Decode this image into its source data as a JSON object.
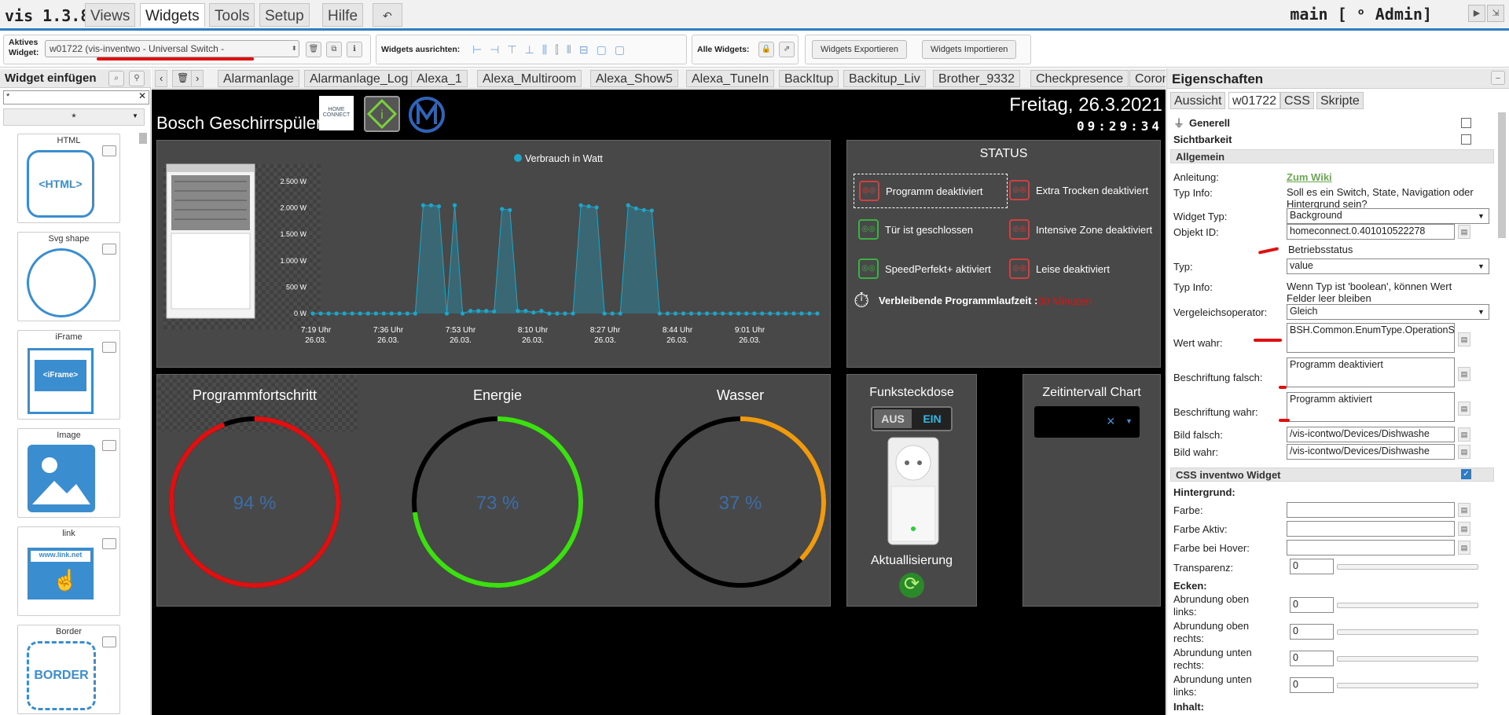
{
  "app": {
    "version": "vis 1.3.8",
    "menu": [
      "Views",
      "Widgets",
      "Tools",
      "Setup",
      "Hilfe"
    ],
    "undo": "↶",
    "project": "main [ ᵒ Admin]"
  },
  "toolbar": {
    "active_label_1": "Aktives",
    "active_label_2": "Widget:",
    "active_widget": "w01722 (vis-inventwo - Universal Switch -",
    "align_label": "Widgets ausrichten:",
    "all_label": "Alle Widgets:",
    "export": "Widgets Exportieren",
    "import": "Widgets Importieren"
  },
  "palette": {
    "title": "Widget einfügen",
    "filter": "*",
    "category": "*",
    "widgets": [
      {
        "name": "HTML",
        "glyph": "<HTML>"
      },
      {
        "name": "Svg shape",
        "glyph": ""
      },
      {
        "name": "iFrame",
        "glyph": "<iFrame>"
      },
      {
        "name": "Image",
        "glyph": ""
      },
      {
        "name": "link",
        "glyph": "www.link.net"
      },
      {
        "name": "Border",
        "glyph": "BORDER"
      }
    ]
  },
  "views": [
    "Alarmanlage",
    "Alarmanlage_Log",
    "Alexa_1",
    "Alexa_Multiroom",
    "Alexa_Show5",
    "Alexa_TuneIn",
    "BackItup",
    "Backitup_Liv",
    "Brother_9332",
    "Checkpresence",
    "Corona_A"
  ],
  "dashboard": {
    "title": "Bosch Geschirrspüler",
    "homeconnect": "HOME CONNECT",
    "date": "Freitag, 26.3.2021",
    "time": "09:29:34",
    "chart_legend": "Verbrauch in Watt",
    "status_title": "STATUS",
    "status": [
      {
        "text": "Programm deaktiviert",
        "color": "#d04040"
      },
      {
        "text": "Extra Trocken deaktiviert",
        "color": "#d04040"
      },
      {
        "text": "Tür ist geschlossen",
        "color": "#3cb043"
      },
      {
        "text": "Intensive Zone deaktiviert",
        "color": "#d04040"
      },
      {
        "text": "SpeedPerfekt+ aktiviert",
        "color": "#3cb043"
      },
      {
        "text": "Leise deaktiviert",
        "color": "#d04040"
      }
    ],
    "remaining_label": "Verbleibende Programmlaufzeit :",
    "remaining_value": "00 Minuten",
    "gauges": [
      {
        "title": "Programmfortschritt",
        "value": 94,
        "label": "94 %",
        "color": "#e01010"
      },
      {
        "title": "Energie",
        "value": 73,
        "label": "73 %",
        "color": "#3ce010"
      },
      {
        "title": "Wasser",
        "value": 37,
        "label": "37 %",
        "color": "#f09a10"
      }
    ],
    "plug_title": "Funksteckdose",
    "plug_off": "AUS",
    "plug_on": "EIN",
    "refresh": "Aktuallisierung",
    "interval_title": "Zeitintervall Chart",
    "interval_x": "×"
  },
  "chart_data": {
    "type": "area",
    "title": "",
    "series": [
      {
        "name": "Verbrauch in Watt",
        "values": [
          0,
          0,
          0,
          0,
          0,
          0,
          0,
          0,
          0,
          0,
          0,
          0,
          0,
          0,
          2050,
          2050,
          2030,
          0,
          2050,
          0,
          50,
          50,
          50,
          40,
          1980,
          1960,
          50,
          50,
          20,
          50,
          0,
          0,
          0,
          0,
          2050,
          2030,
          2010,
          0,
          0,
          0,
          2050,
          1990,
          1960,
          1950,
          0,
          0,
          0,
          0,
          0,
          0,
          0,
          0,
          0,
          0,
          0,
          0,
          0,
          0,
          0,
          0,
          0,
          0,
          0,
          0,
          0
        ]
      }
    ],
    "xticks": [
      "7:19 Uhr\n26.03.",
      "7:36 Uhr\n26.03.",
      "7:53 Uhr\n26.03.",
      "8:10 Uhr\n26.03.",
      "8:27 Uhr\n26.03.",
      "8:44 Uhr\n26.03.",
      "9:01 Uhr\n26.03."
    ],
    "yticks": [
      "2.500 W",
      "2.000 W",
      "1.500 W",
      "1.000 W",
      "500 W",
      "0 W"
    ],
    "ylim": [
      0,
      2500
    ],
    "color": "#1fa5c8"
  },
  "props": {
    "title": "Eigenschaften",
    "tabs": [
      "Aussicht",
      "w01722",
      "CSS",
      "Skripte"
    ],
    "generell": "Generell",
    "sichtbarkeit": "Sichtbarkeit",
    "allgemein": "Allgemein",
    "rows": [
      {
        "label": "Anleitung:",
        "value": "Zum Wiki",
        "kind": "link"
      },
      {
        "label": "Typ Info:",
        "value": "Soll es ein Switch, State, Navigation oder Hintergrund sein?",
        "kind": "text"
      },
      {
        "label": "Widget Typ:",
        "value": "Background",
        "kind": "select"
      },
      {
        "label": "Objekt ID:",
        "value": "homeconnect.0.401010522278",
        "extra": "Betriebsstatus",
        "kind": "input"
      },
      {
        "label": "Typ:",
        "value": "value",
        "kind": "select"
      },
      {
        "label": "Typ Info:",
        "value": "Wenn Typ ist 'boolean', können Wert Felder leer bleiben",
        "kind": "text"
      },
      {
        "label": "Vergeleichsoperator:",
        "value": "Gleich",
        "kind": "select"
      },
      {
        "label": "Wert wahr:",
        "value": "BSH.Common.EnumType.OperationState.Run",
        "kind": "area"
      },
      {
        "label": "Beschriftung falsch:",
        "value": "Programm deaktiviert",
        "kind": "area"
      },
      {
        "label": "Beschriftung wahr:",
        "value": "Programm aktiviert",
        "kind": "area"
      },
      {
        "label": "Bild falsch:",
        "value": "/vis-icontwo/Devices/Dishwashe",
        "kind": "input"
      },
      {
        "label": "Bild wahr:",
        "value": "/vis-icontwo/Devices/Dishwashe",
        "kind": "input"
      }
    ],
    "css_section": "CSS inventwo Widget",
    "hintergrund": "Hintergrund:",
    "color_rows": [
      "Farbe:",
      "Farbe Aktiv:",
      "Farbe bei Hover:"
    ],
    "transparenz": "Transparenz:",
    "transparenz_val": "0",
    "ecken": "Ecken:",
    "corner_rows": [
      [
        "Abrundung oben",
        "links:"
      ],
      [
        "Abrundung oben",
        "rechts:"
      ],
      [
        "Abrundung unten",
        "rechts:"
      ],
      [
        "Abrundung unten",
        "links:"
      ]
    ],
    "corner_val": "0",
    "inhalt": "Inhalt:"
  }
}
